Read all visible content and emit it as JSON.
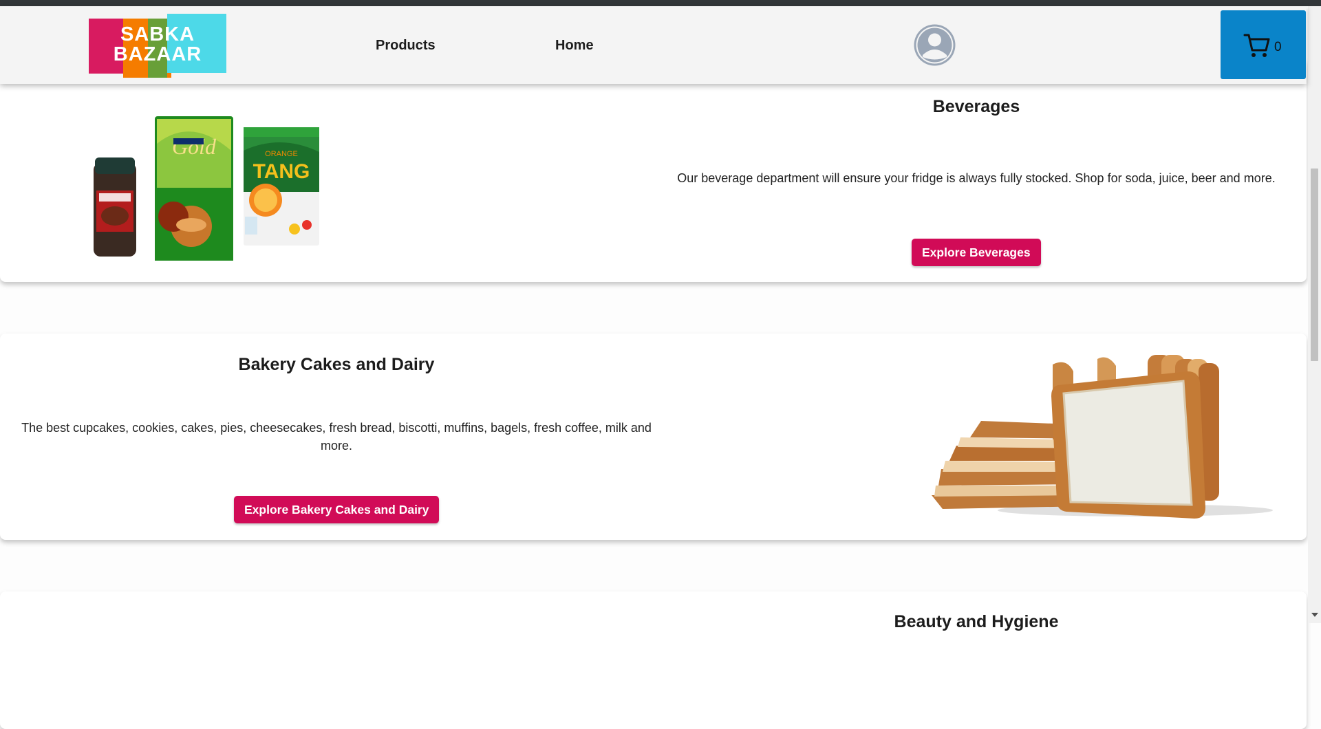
{
  "header": {
    "logo_line1": "SABKA",
    "logo_line2": "BAZAAR",
    "nav": {
      "products": "Products",
      "home": "Home"
    },
    "cart_count": "0"
  },
  "categories": [
    {
      "title": "Beverages",
      "description": "Our beverage department will ensure your fridge is always fully stocked. Shop for soda, juice, beer and more.",
      "button": "Explore Beverages"
    },
    {
      "title": "Bakery Cakes and Dairy",
      "description": "The best cupcakes, cookies, cakes, pies, cheesecakes, fresh bread, biscotti, muffins, bagels, fresh coffee, milk and more.",
      "button": "Explore Bakery Cakes and Dairy"
    },
    {
      "title": "Beauty and Hygiene"
    }
  ],
  "colors": {
    "accent": "#d10b57",
    "cart_bg": "#0a84c9",
    "header_bg": "#f4f4f4"
  },
  "icons": {
    "user": "user-avatar-icon",
    "cart": "cart-icon"
  }
}
